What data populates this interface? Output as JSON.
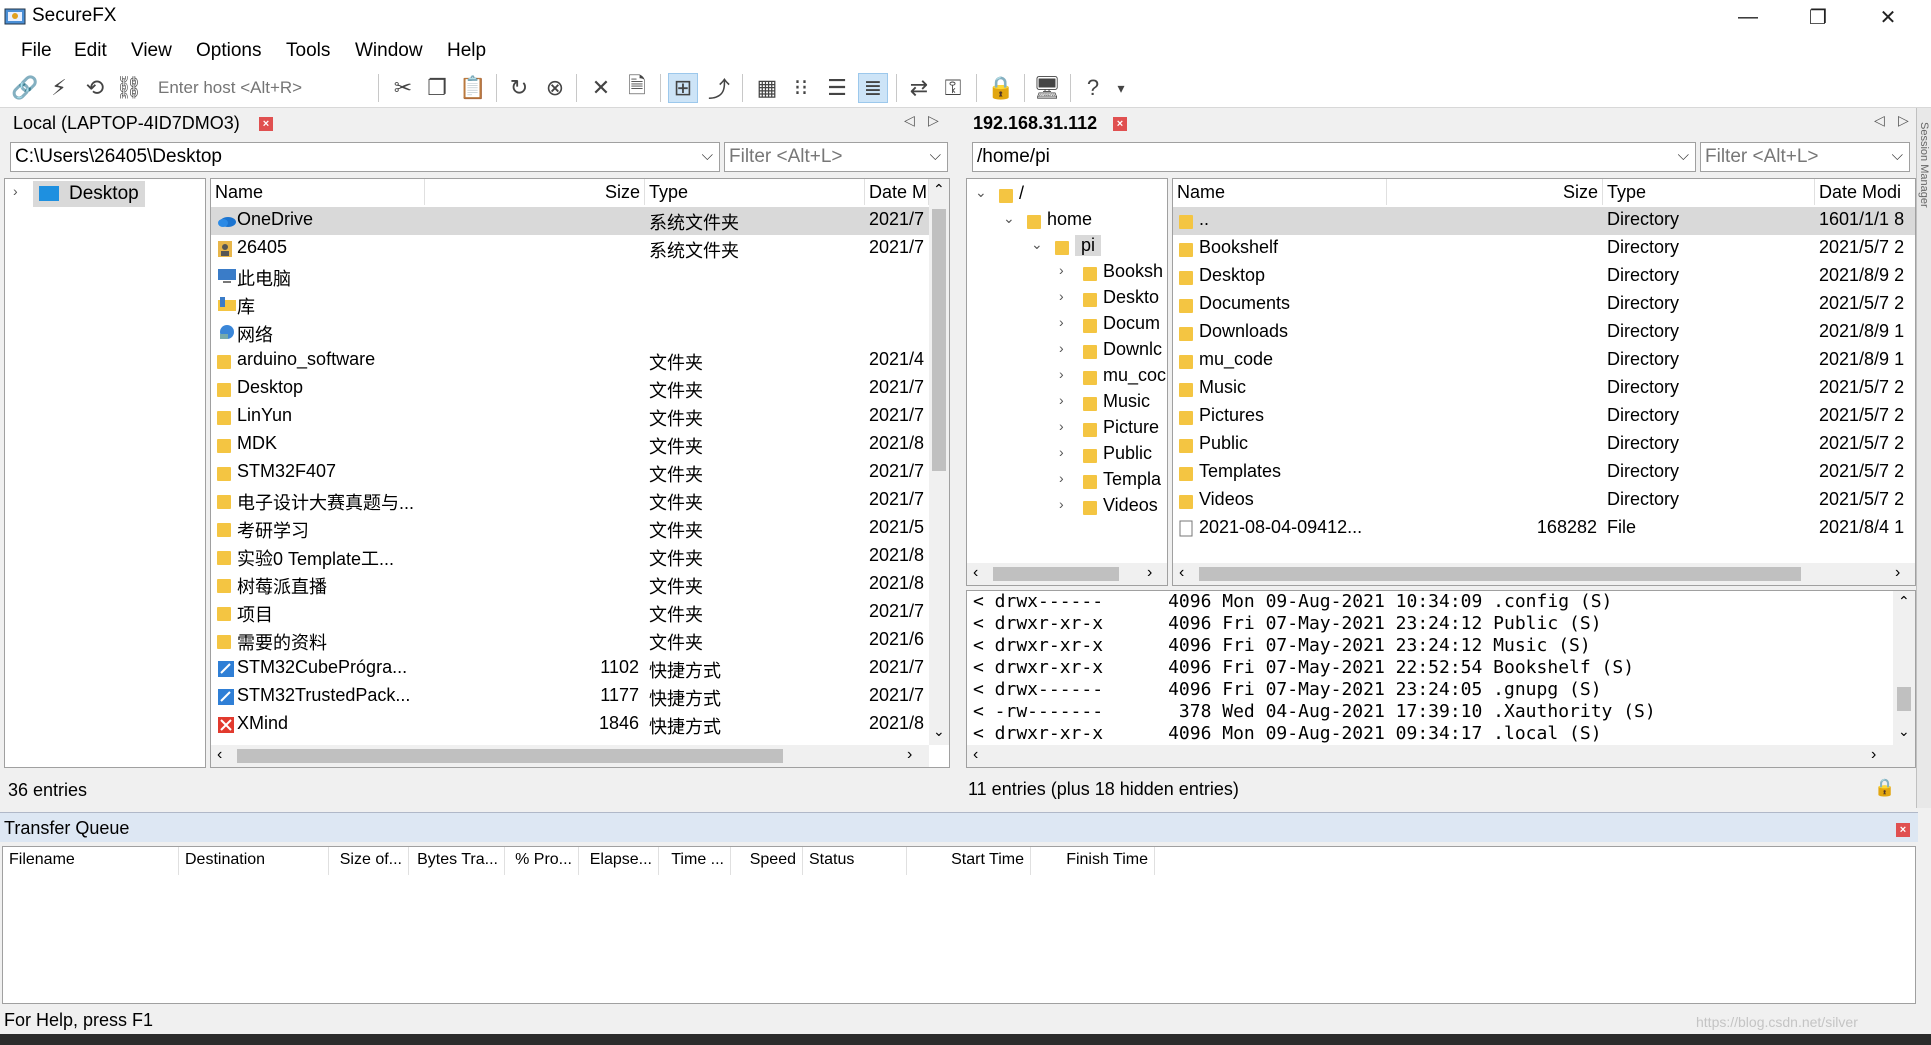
{
  "app": {
    "title": "SecureFX",
    "controls": {
      "minimize": "—",
      "maximize": "❐",
      "close": "✕"
    }
  },
  "menu": [
    "File",
    "Edit",
    "View",
    "Options",
    "Tools",
    "Window",
    "Help"
  ],
  "toolbar": {
    "host_placeholder": "Enter host <Alt+R>"
  },
  "local": {
    "tab_title": "Local (LAPTOP-4ID7DMO3)",
    "path": "C:\\Users\\26405\\Desktop",
    "filter_placeholder": "Filter <Alt+L>",
    "tree_item": "Desktop",
    "columns": [
      "Name",
      "Size",
      "Type",
      "Date M"
    ],
    "rows": [
      {
        "name": "OneDrive",
        "size": "",
        "type": "系统文件夹",
        "date": "2021/7",
        "icon": "onedrive-icon"
      },
      {
        "name": "26405",
        "size": "",
        "type": "系统文件夹",
        "date": "2021/7",
        "icon": "user-icon"
      },
      {
        "name": "此电脑",
        "size": "",
        "type": "",
        "date": "",
        "icon": "computer-icon"
      },
      {
        "name": "库",
        "size": "",
        "type": "",
        "date": "",
        "icon": "library-icon"
      },
      {
        "name": "网络",
        "size": "",
        "type": "",
        "date": "",
        "icon": "network-icon"
      },
      {
        "name": "arduino_software",
        "size": "",
        "type": "文件夹",
        "date": "2021/4",
        "icon": "folder-icon"
      },
      {
        "name": "Desktop",
        "size": "",
        "type": "文件夹",
        "date": "2021/7",
        "icon": "folder-icon"
      },
      {
        "name": "LinYun",
        "size": "",
        "type": "文件夹",
        "date": "2021/7",
        "icon": "folder-icon"
      },
      {
        "name": "MDK",
        "size": "",
        "type": "文件夹",
        "date": "2021/8",
        "icon": "folder-icon"
      },
      {
        "name": "STM32F407",
        "size": "",
        "type": "文件夹",
        "date": "2021/7",
        "icon": "folder-icon"
      },
      {
        "name": "电子设计大赛真题与...",
        "size": "",
        "type": "文件夹",
        "date": "2021/7",
        "icon": "folder-icon"
      },
      {
        "name": "考研学习",
        "size": "",
        "type": "文件夹",
        "date": "2021/5",
        "icon": "folder-icon"
      },
      {
        "name": "实验0 Template工...",
        "size": "",
        "type": "文件夹",
        "date": "2021/8",
        "icon": "folder-icon"
      },
      {
        "name": "树莓派直播",
        "size": "",
        "type": "文件夹",
        "date": "2021/8",
        "icon": "folder-icon"
      },
      {
        "name": "项目",
        "size": "",
        "type": "文件夹",
        "date": "2021/7",
        "icon": "folder-icon"
      },
      {
        "name": "需要的资料",
        "size": "",
        "type": "文件夹",
        "date": "2021/6",
        "icon": "folder-icon"
      },
      {
        "name": "STM32CubePrógra...",
        "size": "1102",
        "type": "快捷方式",
        "date": "2021/7",
        "icon": "shortcut-icon"
      },
      {
        "name": "STM32TrustedPack...",
        "size": "1177",
        "type": "快捷方式",
        "date": "2021/7",
        "icon": "shortcut-icon"
      },
      {
        "name": "XMind",
        "size": "1846",
        "type": "快捷方式",
        "date": "2021/8",
        "icon": "xmind-icon"
      }
    ],
    "status": "36 entries"
  },
  "remote": {
    "tab_title": "192.168.31.112",
    "path": "/home/pi",
    "filter_placeholder": "Filter <Alt+L>",
    "tree": [
      {
        "label": "/",
        "level": 0,
        "expanded": true
      },
      {
        "label": "home",
        "level": 1,
        "expanded": true
      },
      {
        "label": "pi",
        "level": 2,
        "expanded": true,
        "selected": true
      },
      {
        "label": "Booksh",
        "level": 3
      },
      {
        "label": "Deskto",
        "level": 3
      },
      {
        "label": "Docum",
        "level": 3
      },
      {
        "label": "Downlc",
        "level": 3
      },
      {
        "label": "mu_coc",
        "level": 3
      },
      {
        "label": "Music",
        "level": 3
      },
      {
        "label": "Picture",
        "level": 3
      },
      {
        "label": "Public",
        "level": 3
      },
      {
        "label": "Templa",
        "level": 3
      },
      {
        "label": "Videos",
        "level": 3
      }
    ],
    "columns": [
      "Name",
      "Size",
      "Type",
      "Date Modi"
    ],
    "rows": [
      {
        "name": "..",
        "size": "",
        "type": "Directory",
        "date": "1601/1/1 8"
      },
      {
        "name": "Bookshelf",
        "size": "",
        "type": "Directory",
        "date": "2021/5/7 2"
      },
      {
        "name": "Desktop",
        "size": "",
        "type": "Directory",
        "date": "2021/8/9 2"
      },
      {
        "name": "Documents",
        "size": "",
        "type": "Directory",
        "date": "2021/5/7 2"
      },
      {
        "name": "Downloads",
        "size": "",
        "type": "Directory",
        "date": "2021/8/9 1"
      },
      {
        "name": "mu_code",
        "size": "",
        "type": "Directory",
        "date": "2021/8/9 1"
      },
      {
        "name": "Music",
        "size": "",
        "type": "Directory",
        "date": "2021/5/7 2"
      },
      {
        "name": "Pictures",
        "size": "",
        "type": "Directory",
        "date": "2021/5/7 2"
      },
      {
        "name": "Public",
        "size": "",
        "type": "Directory",
        "date": "2021/5/7 2"
      },
      {
        "name": "Templates",
        "size": "",
        "type": "Directory",
        "date": "2021/5/7 2"
      },
      {
        "name": "Videos",
        "size": "",
        "type": "Directory",
        "date": "2021/5/7 2"
      },
      {
        "name": "2021-08-04-09412...",
        "size": "168282",
        "type": "File",
        "date": "2021/8/4 1"
      }
    ],
    "log": [
      "< drwx------      4096 Mon 09-Aug-2021 10:34:09 .config (S)",
      "< drwxr-xr-x      4096 Fri 07-May-2021 23:24:12 Public (S)",
      "< drwxr-xr-x      4096 Fri 07-May-2021 23:24:12 Music (S)",
      "< drwxr-xr-x      4096 Fri 07-May-2021 22:52:54 Bookshelf (S)",
      "< drwx------      4096 Fri 07-May-2021 23:24:05 .gnupg (S)",
      "< -rw-------       378 Wed 04-Aug-2021 17:39:10 .Xauthority (S)",
      "< drwxr-xr-x      4096 Mon 09-Aug-2021 09:34:17 .local (S)"
    ],
    "status": "11 entries (plus 18 hidden entries)"
  },
  "session_manager_label": "Session Manager",
  "transfer_queue": {
    "title": "Transfer Queue",
    "columns": [
      "Filename",
      "Destination",
      "Size of...",
      "Bytes Tra...",
      "% Pro...",
      "Elapse...",
      "Time ...",
      "Speed",
      "Status",
      "Start Time",
      "Finish Time"
    ]
  },
  "statusbar": {
    "help": "For Help, press F1",
    "watermark": "https://blog.csdn.net/silver"
  },
  "colors": {
    "folder": "#f4c542",
    "selection": "#d9d9d9",
    "close_red": "#e05050"
  }
}
